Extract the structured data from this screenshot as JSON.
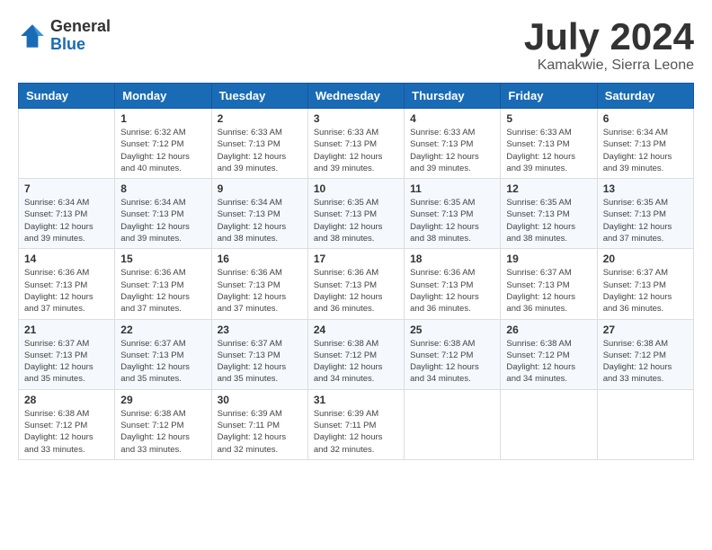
{
  "header": {
    "logo_general": "General",
    "logo_blue": "Blue",
    "month_title": "July 2024",
    "location": "Kamakwie, Sierra Leone"
  },
  "calendar": {
    "days_of_week": [
      "Sunday",
      "Monday",
      "Tuesday",
      "Wednesday",
      "Thursday",
      "Friday",
      "Saturday"
    ],
    "weeks": [
      [
        {
          "day": "",
          "info": ""
        },
        {
          "day": "1",
          "info": "Sunrise: 6:32 AM\nSunset: 7:12 PM\nDaylight: 12 hours\nand 40 minutes."
        },
        {
          "day": "2",
          "info": "Sunrise: 6:33 AM\nSunset: 7:13 PM\nDaylight: 12 hours\nand 39 minutes."
        },
        {
          "day": "3",
          "info": "Sunrise: 6:33 AM\nSunset: 7:13 PM\nDaylight: 12 hours\nand 39 minutes."
        },
        {
          "day": "4",
          "info": "Sunrise: 6:33 AM\nSunset: 7:13 PM\nDaylight: 12 hours\nand 39 minutes."
        },
        {
          "day": "5",
          "info": "Sunrise: 6:33 AM\nSunset: 7:13 PM\nDaylight: 12 hours\nand 39 minutes."
        },
        {
          "day": "6",
          "info": "Sunrise: 6:34 AM\nSunset: 7:13 PM\nDaylight: 12 hours\nand 39 minutes."
        }
      ],
      [
        {
          "day": "7",
          "info": "Sunrise: 6:34 AM\nSunset: 7:13 PM\nDaylight: 12 hours\nand 39 minutes."
        },
        {
          "day": "8",
          "info": "Sunrise: 6:34 AM\nSunset: 7:13 PM\nDaylight: 12 hours\nand 39 minutes."
        },
        {
          "day": "9",
          "info": "Sunrise: 6:34 AM\nSunset: 7:13 PM\nDaylight: 12 hours\nand 38 minutes."
        },
        {
          "day": "10",
          "info": "Sunrise: 6:35 AM\nSunset: 7:13 PM\nDaylight: 12 hours\nand 38 minutes."
        },
        {
          "day": "11",
          "info": "Sunrise: 6:35 AM\nSunset: 7:13 PM\nDaylight: 12 hours\nand 38 minutes."
        },
        {
          "day": "12",
          "info": "Sunrise: 6:35 AM\nSunset: 7:13 PM\nDaylight: 12 hours\nand 38 minutes."
        },
        {
          "day": "13",
          "info": "Sunrise: 6:35 AM\nSunset: 7:13 PM\nDaylight: 12 hours\nand 37 minutes."
        }
      ],
      [
        {
          "day": "14",
          "info": "Sunrise: 6:36 AM\nSunset: 7:13 PM\nDaylight: 12 hours\nand 37 minutes."
        },
        {
          "day": "15",
          "info": "Sunrise: 6:36 AM\nSunset: 7:13 PM\nDaylight: 12 hours\nand 37 minutes."
        },
        {
          "day": "16",
          "info": "Sunrise: 6:36 AM\nSunset: 7:13 PM\nDaylight: 12 hours\nand 37 minutes."
        },
        {
          "day": "17",
          "info": "Sunrise: 6:36 AM\nSunset: 7:13 PM\nDaylight: 12 hours\nand 36 minutes."
        },
        {
          "day": "18",
          "info": "Sunrise: 6:36 AM\nSunset: 7:13 PM\nDaylight: 12 hours\nand 36 minutes."
        },
        {
          "day": "19",
          "info": "Sunrise: 6:37 AM\nSunset: 7:13 PM\nDaylight: 12 hours\nand 36 minutes."
        },
        {
          "day": "20",
          "info": "Sunrise: 6:37 AM\nSunset: 7:13 PM\nDaylight: 12 hours\nand 36 minutes."
        }
      ],
      [
        {
          "day": "21",
          "info": "Sunrise: 6:37 AM\nSunset: 7:13 PM\nDaylight: 12 hours\nand 35 minutes."
        },
        {
          "day": "22",
          "info": "Sunrise: 6:37 AM\nSunset: 7:13 PM\nDaylight: 12 hours\nand 35 minutes."
        },
        {
          "day": "23",
          "info": "Sunrise: 6:37 AM\nSunset: 7:13 PM\nDaylight: 12 hours\nand 35 minutes."
        },
        {
          "day": "24",
          "info": "Sunrise: 6:38 AM\nSunset: 7:12 PM\nDaylight: 12 hours\nand 34 minutes."
        },
        {
          "day": "25",
          "info": "Sunrise: 6:38 AM\nSunset: 7:12 PM\nDaylight: 12 hours\nand 34 minutes."
        },
        {
          "day": "26",
          "info": "Sunrise: 6:38 AM\nSunset: 7:12 PM\nDaylight: 12 hours\nand 34 minutes."
        },
        {
          "day": "27",
          "info": "Sunrise: 6:38 AM\nSunset: 7:12 PM\nDaylight: 12 hours\nand 33 minutes."
        }
      ],
      [
        {
          "day": "28",
          "info": "Sunrise: 6:38 AM\nSunset: 7:12 PM\nDaylight: 12 hours\nand 33 minutes."
        },
        {
          "day": "29",
          "info": "Sunrise: 6:38 AM\nSunset: 7:12 PM\nDaylight: 12 hours\nand 33 minutes."
        },
        {
          "day": "30",
          "info": "Sunrise: 6:39 AM\nSunset: 7:11 PM\nDaylight: 12 hours\nand 32 minutes."
        },
        {
          "day": "31",
          "info": "Sunrise: 6:39 AM\nSunset: 7:11 PM\nDaylight: 12 hours\nand 32 minutes."
        },
        {
          "day": "",
          "info": ""
        },
        {
          "day": "",
          "info": ""
        },
        {
          "day": "",
          "info": ""
        }
      ]
    ]
  }
}
